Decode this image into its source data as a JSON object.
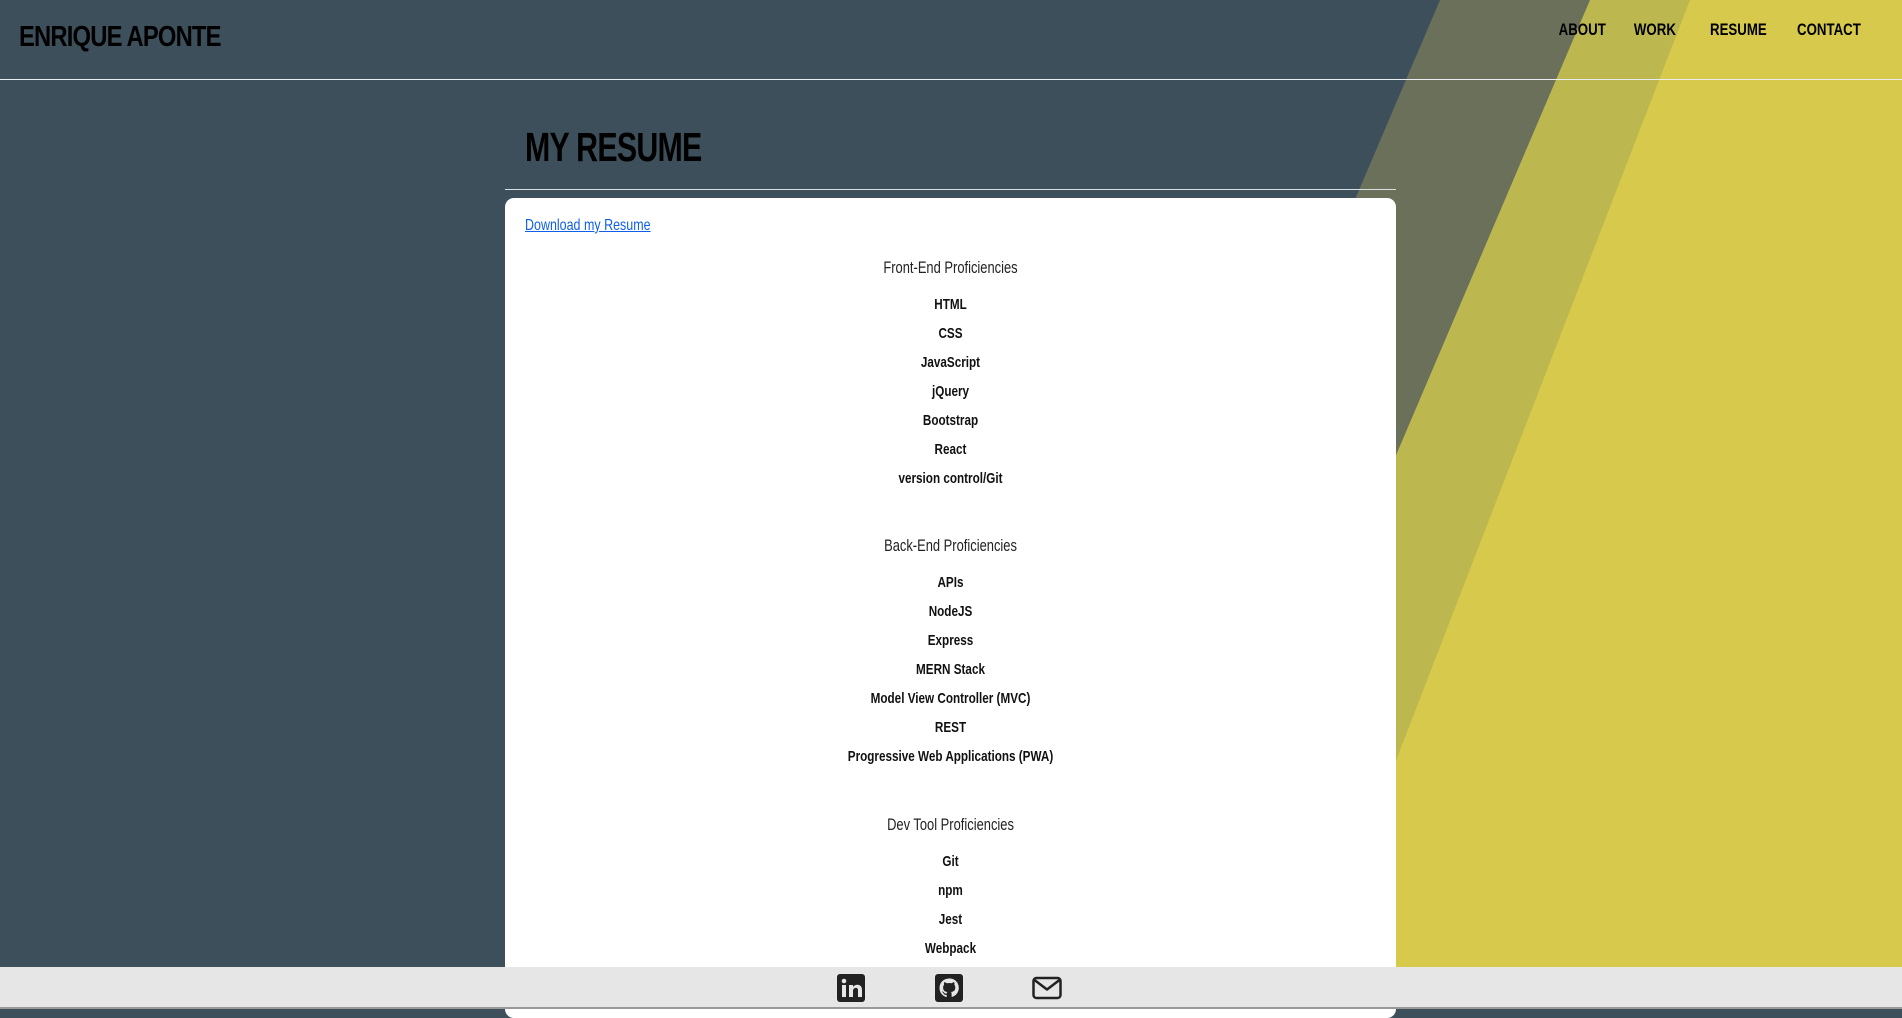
{
  "header": {
    "brand": "ENRIQUE APONTE",
    "nav": [
      "ABOUT",
      "WORK",
      "RESUME",
      "CONTACT"
    ]
  },
  "main": {
    "title": "MY RESUME",
    "download_label": "Download my Resume",
    "sections": [
      {
        "title": "Front-End Proficiencies",
        "items": [
          "HTML",
          "CSS",
          "JavaScript",
          "jQuery",
          "Bootstrap",
          "React",
          "version control/Git"
        ]
      },
      {
        "title": "Back-End Proficiencies",
        "items": [
          "APIs",
          "NodeJS",
          "Express",
          "MERN Stack",
          "Model View Controller (MVC)",
          "REST",
          "Progressive Web Applications (PWA)"
        ]
      },
      {
        "title": "Dev Tool Proficiencies",
        "items": [
          "Git",
          "npm",
          "Jest",
          "Webpack"
        ]
      }
    ]
  },
  "footer": {
    "icons": [
      "linkedin-icon",
      "github-icon",
      "email-icon"
    ]
  },
  "colors": {
    "background": "#3d4f5a",
    "accent_yellow": "#d6c94c",
    "accent_olive": "#6a705a",
    "link": "#0f5fe8",
    "footer": "#e6e6e6"
  }
}
